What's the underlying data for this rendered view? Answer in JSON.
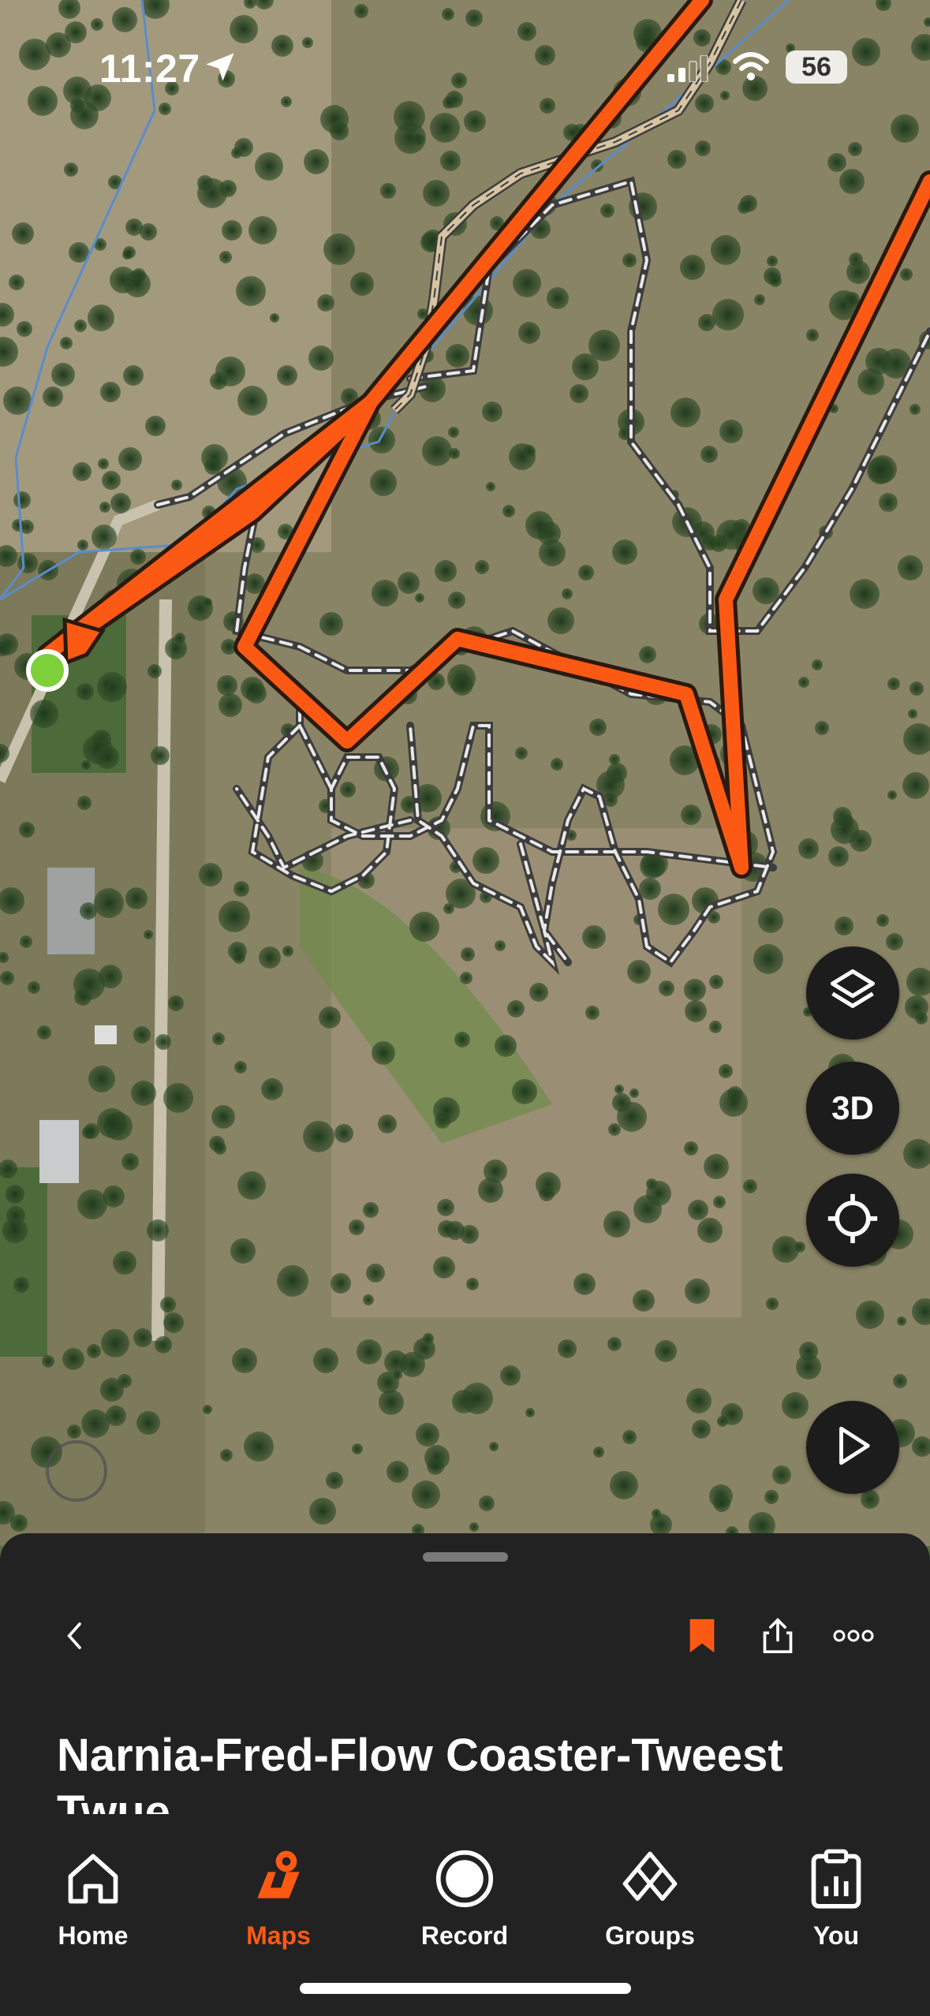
{
  "status_bar": {
    "time": "11:27",
    "battery": "56"
  },
  "map": {
    "controls": [
      "layers-icon",
      "3d-toggle",
      "locate-icon",
      "play-icon"
    ],
    "three_d_label": "3D"
  },
  "sheet": {
    "title": "Narnia-Fred-Flow Coaster-Tweest Twue",
    "accent": "#fc5a14"
  },
  "tabs": [
    {
      "label": "Home",
      "icon": "home-icon",
      "active": false
    },
    {
      "label": "Maps",
      "icon": "maps-icon",
      "active": true
    },
    {
      "label": "Record",
      "icon": "record-icon",
      "active": false
    },
    {
      "label": "Groups",
      "icon": "groups-icon",
      "active": false
    },
    {
      "label": "You",
      "icon": "clipboard-icon",
      "active": false
    }
  ]
}
